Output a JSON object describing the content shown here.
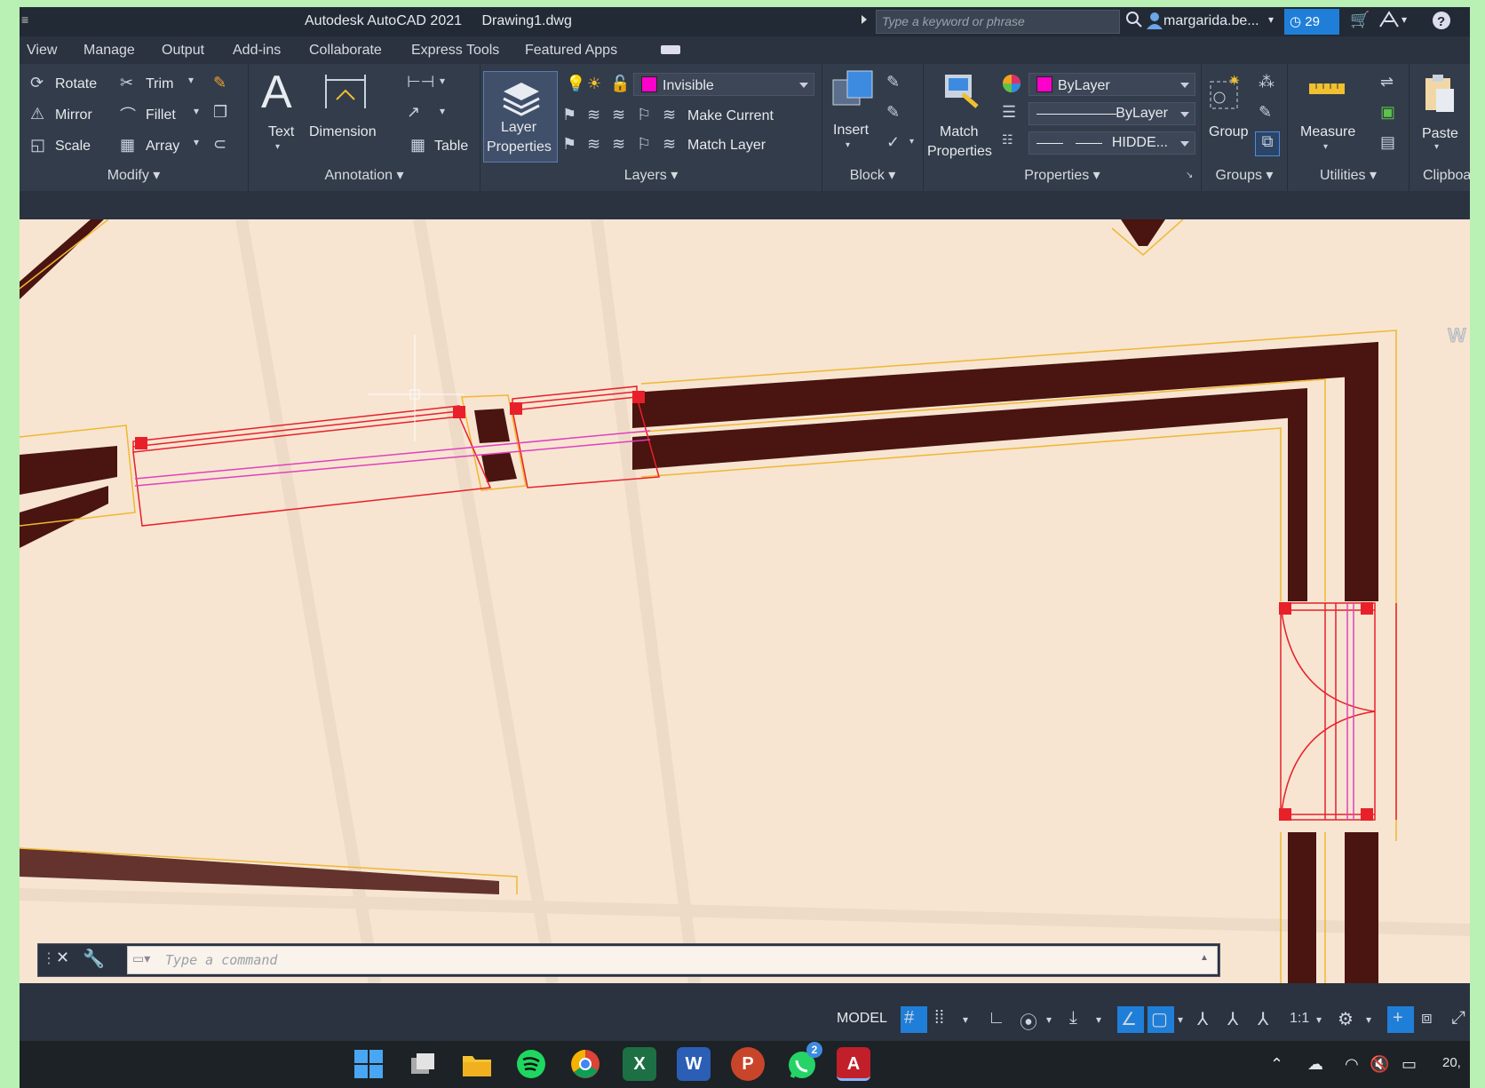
{
  "window": {
    "app": "Autodesk AutoCAD 2021",
    "document": "Drawing1.dwg"
  },
  "search": {
    "placeholder": "Type a keyword or phrase"
  },
  "user": {
    "name": "margarida.be...",
    "badge_count": "29"
  },
  "menu": [
    "View",
    "Manage",
    "Output",
    "Add-ins",
    "Collaborate",
    "Express Tools",
    "Featured Apps"
  ],
  "modify": {
    "title": "Modify",
    "rotate": "Rotate",
    "trim": "Trim",
    "mirror": "Mirror",
    "fillet": "Fillet",
    "scale": "Scale",
    "array": "Array"
  },
  "annotation": {
    "title": "Annotation",
    "text": "Text",
    "dimension": "Dimension",
    "table": "Table"
  },
  "layers": {
    "title": "Layers",
    "layer_properties_1": "Layer",
    "layer_properties_2": "Properties",
    "current_layer": "Invisible",
    "make_current": "Make Current",
    "match_layer": "Match Layer"
  },
  "block": {
    "title": "Block",
    "insert": "Insert"
  },
  "properties": {
    "title": "Properties",
    "match_1": "Match",
    "match_2": "Properties",
    "color": "ByLayer",
    "lineweight": "ByLayer",
    "linetype": "HIDDE..."
  },
  "groups": {
    "title": "Groups",
    "group": "Group"
  },
  "utilities": {
    "title": "Utilities",
    "measure": "Measure"
  },
  "clipboard": {
    "title": "Clipboard",
    "paste": "Paste"
  },
  "viewcube": {
    "west": "W"
  },
  "command": {
    "placeholder": "Type a command"
  },
  "status": {
    "model": "MODEL",
    "scale": "1:1"
  },
  "taskbar": {
    "whatsapp_badge": "2",
    "clock": "20,"
  },
  "colors": {
    "accent": "#1f7fd8",
    "layer_swatch": "#ff00cc"
  }
}
